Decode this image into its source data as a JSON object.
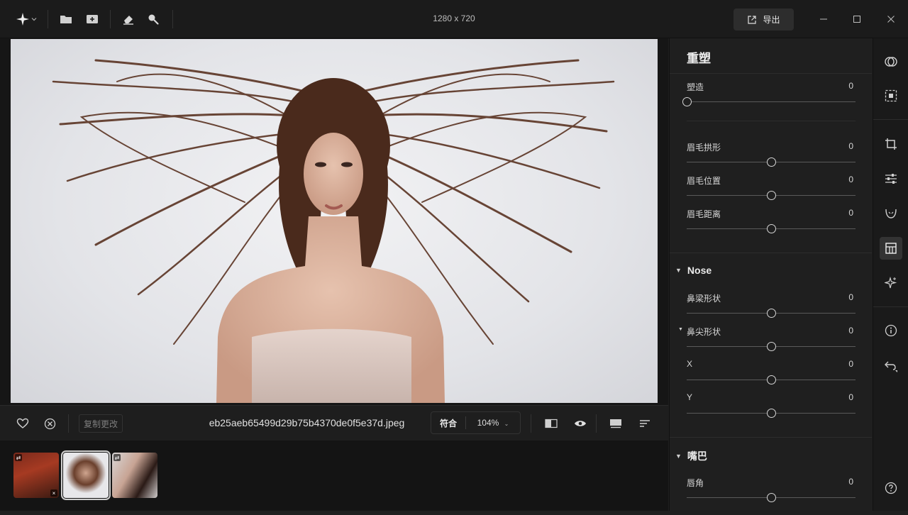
{
  "titlebar": {
    "dimensions": "1280 x 720",
    "export_label": "导出",
    "icons": [
      "star-logo-icon",
      "chevron-down-icon",
      "folder-icon",
      "add-image-icon",
      "eraser-icon",
      "magnifier-icon"
    ]
  },
  "bottombar": {
    "copy_changes_label": "复制更改",
    "filename": "eb25aeb65499d29b75b4370de0f5e37d.jpeg",
    "zoom_fit_label": "符合",
    "zoom_value": "104%"
  },
  "panel": {
    "title": "重塑",
    "sections": {
      "nose_title": "Nose",
      "mouth_title": "嘴巴"
    },
    "sliders": [
      {
        "label": "塑造",
        "value": "0",
        "level": 0.0
      },
      {
        "label": "眉毛拱形",
        "value": "0",
        "level": 0.5
      },
      {
        "label": "眉毛位置",
        "value": "0",
        "level": 0.5
      },
      {
        "label": "眉毛距离",
        "value": "0",
        "level": 0.5
      },
      {
        "label": "鼻梁形状",
        "value": "0",
        "level": 0.5
      },
      {
        "label": "鼻尖形状",
        "value": "0",
        "level": 0.5
      },
      {
        "label": "X",
        "value": "0",
        "level": 0.5
      },
      {
        "label": "Y",
        "value": "0",
        "level": 0.5
      },
      {
        "label": "唇角",
        "value": "0",
        "level": 0.5
      }
    ]
  },
  "toolstrip": {
    "icons": [
      "overlay-circles-icon",
      "select-frame-icon",
      "crop-icon",
      "adjust-sliders-icon",
      "face-retouch-icon",
      "reshape-grid-icon",
      "sparkle-icon",
      "info-icon",
      "undo-icon",
      "help-icon"
    ],
    "active": "reshape-grid-icon"
  },
  "colors": {
    "background": "#1f1f1f",
    "panel": "#1f1f1f",
    "accent": "#d6d6d6"
  }
}
